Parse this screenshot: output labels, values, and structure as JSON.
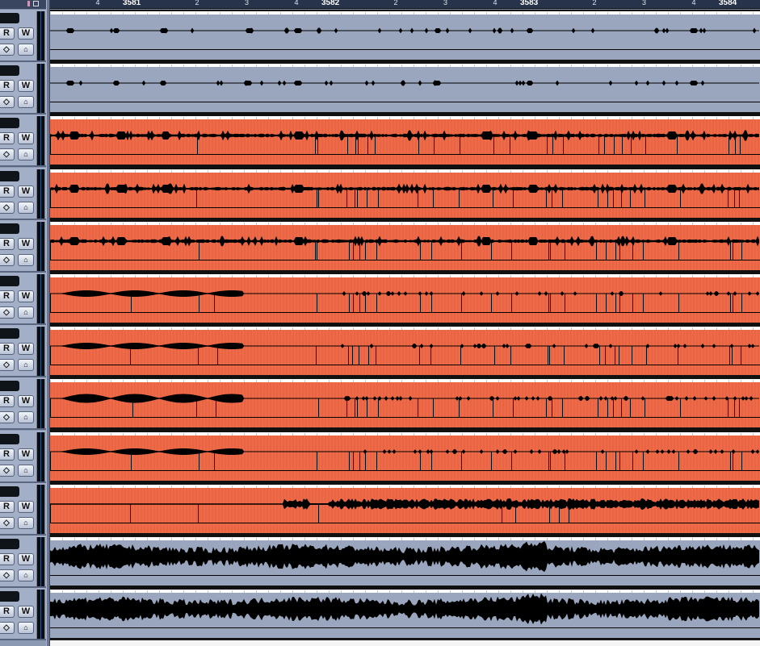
{
  "ruler": {
    "labels": [
      {
        "text": "4",
        "beat": -1,
        "bar": false
      },
      {
        "text": "3581",
        "beat": 0,
        "bar": true
      },
      {
        "text": "2",
        "beat": 1,
        "bar": false
      },
      {
        "text": "3",
        "beat": 2,
        "bar": false
      },
      {
        "text": "4",
        "beat": 3,
        "bar": false
      },
      {
        "text": "3582",
        "beat": 4,
        "bar": true
      },
      {
        "text": "2",
        "beat": 5,
        "bar": false
      },
      {
        "text": "3",
        "beat": 6,
        "bar": false
      },
      {
        "text": "4",
        "beat": 7,
        "bar": false
      },
      {
        "text": "3583",
        "beat": 8,
        "bar": true
      },
      {
        "text": "2",
        "beat": 9,
        "bar": false
      },
      {
        "text": "3",
        "beat": 10,
        "bar": false
      },
      {
        "text": "4",
        "beat": 11,
        "bar": false
      },
      {
        "text": "3584",
        "beat": 12,
        "bar": true
      }
    ]
  },
  "buttons": {
    "read": "R",
    "write": "W",
    "edit_icon": "◇",
    "lane_icon": "⌂"
  },
  "colors": {
    "audio_gray": "#9aa6bd",
    "audio_orange": "#f06a48",
    "waveform": "#000000",
    "ruler_bg": "#26334a"
  },
  "tracks": [
    {
      "color": "gray",
      "style": "sparse"
    },
    {
      "color": "gray",
      "style": "sparse"
    },
    {
      "color": "orange",
      "style": "moderate"
    },
    {
      "color": "orange",
      "style": "moderate"
    },
    {
      "color": "orange",
      "style": "moderate"
    },
    {
      "color": "orange",
      "style": "swell"
    },
    {
      "color": "orange",
      "style": "swell"
    },
    {
      "color": "orange",
      "style": "swell"
    },
    {
      "color": "orange",
      "style": "swell"
    },
    {
      "color": "orange",
      "style": "late-heavy"
    },
    {
      "color": "gray",
      "style": "dense"
    },
    {
      "color": "gray",
      "style": "dense"
    }
  ]
}
